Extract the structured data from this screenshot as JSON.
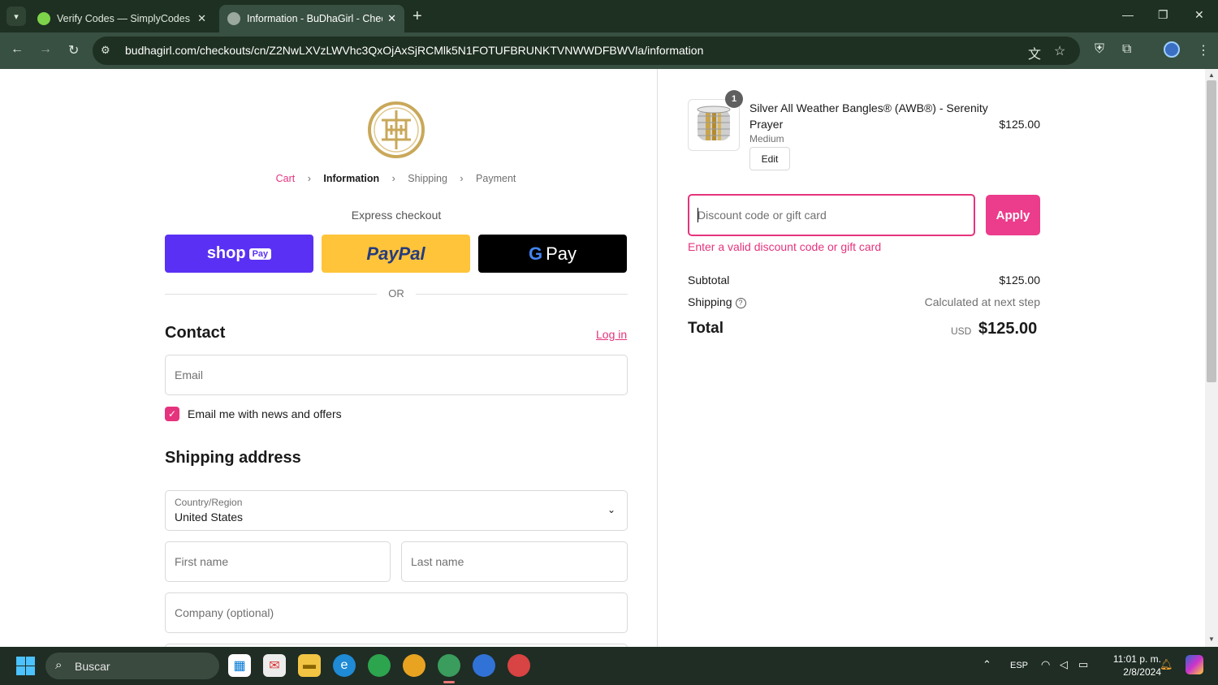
{
  "browser": {
    "tabs": [
      {
        "title": "Verify Codes — SimplyCodes",
        "active": false
      },
      {
        "title": "Information - BuDhaGirl - Checkout",
        "active": true
      }
    ],
    "url": "budhagirl.com/checkouts/cn/Z2NwLXVzLWVhc3QxOjAxSjRCMlk5N1FOTUFBRUNKTVNWWDFBWVla/information"
  },
  "checkout": {
    "breadcrumbs": [
      "Cart",
      "Information",
      "Shipping",
      "Payment"
    ],
    "express_checkout_label": "Express checkout",
    "shoppay_label": "shop",
    "shoppay_badge": "Pay",
    "paypal_label": "PayPal",
    "gpay_label": "Pay",
    "or_label": "OR",
    "contact_heading": "Contact",
    "login_link": "Log in",
    "email_placeholder": "Email",
    "news_checkbox_label": "Email me with news and offers",
    "news_checked": true,
    "shipping_heading": "Shipping address",
    "country_label": "Country/Region",
    "country_value": "United States",
    "first_name_placeholder": "First name",
    "last_name_placeholder": "Last name",
    "company_placeholder": "Company (optional)"
  },
  "summary": {
    "product": {
      "quantity": "1",
      "title": "Silver All Weather Bangles® (AWB®) - Serenity Prayer",
      "variant": "Medium",
      "edit_label": "Edit",
      "price": "$125.00"
    },
    "discount_placeholder": "Discount code or gift card",
    "apply_label": "Apply",
    "discount_error": "Enter a valid discount code or gift card",
    "subtotal_label": "Subtotal",
    "subtotal_value": "$125.00",
    "shipping_label": "Shipping",
    "shipping_value": "Calculated at next step",
    "total_label": "Total",
    "total_currency": "USD",
    "total_value": "$125.00"
  },
  "taskbar": {
    "search_label": "Buscar",
    "language": "ESP",
    "time": "11:01 p. m.",
    "date": "2/8/2024"
  },
  "colors": {
    "accent": "#e5337d",
    "shoppay": "#5a31f4",
    "paypal": "#ffc439",
    "browser_frame": "#1e3021"
  }
}
